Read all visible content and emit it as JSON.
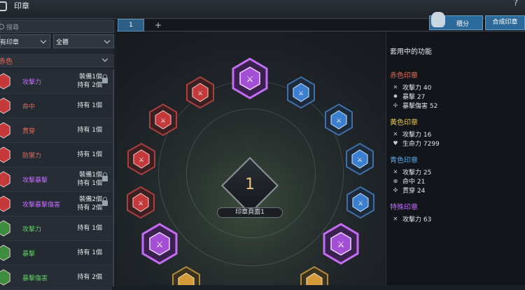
{
  "window": {
    "title": "印章",
    "help": "?"
  },
  "left": {
    "search_placeholder": "搜尋",
    "filter1": "有印章",
    "filter2": "全體",
    "category": "赤色",
    "items": [
      {
        "name": "攻擊力",
        "equipped": "裝備1個",
        "owned": "持有 2個",
        "locked": true,
        "color": "#c36bff"
      },
      {
        "name": "命中",
        "equipped": "",
        "owned": "持有 1個",
        "locked": false,
        "color": "#e86b5a"
      },
      {
        "name": "貫穿",
        "equipped": "",
        "owned": "持有 1個",
        "locked": false,
        "color": "#e86b5a"
      },
      {
        "name": "防禦力",
        "equipped": "",
        "owned": "持有 1個",
        "locked": false,
        "color": "#e86b5a"
      },
      {
        "name": "攻擊暴擊",
        "equipped": "裝備1個",
        "owned": "持有 1個",
        "locked": true,
        "color": "#c36bff"
      },
      {
        "name": "攻擊暴擊傷害",
        "equipped": "裝備2個",
        "owned": "持有 2個",
        "locked": true,
        "color": "#c36bff"
      },
      {
        "name": "攻擊力",
        "equipped": "",
        "owned": "持有 1個",
        "locked": false,
        "color": "#5fd05f"
      },
      {
        "name": "暴擊",
        "equipped": "",
        "owned": "持有 1個",
        "locked": false,
        "color": "#5fd05f"
      },
      {
        "name": "暴擊傷害",
        "equipped": "",
        "owned": "持有 2個",
        "locked": false,
        "color": "#5fd05f"
      }
    ]
  },
  "tabs": {
    "active": "1",
    "add": "+"
  },
  "core": {
    "number": "1",
    "label": "印章頁面1"
  },
  "top_buttons": {
    "score": "積分",
    "merge": "合成印章"
  },
  "panel": {
    "title": "套用中的功能",
    "groups": [
      {
        "name": "赤色印章",
        "color": "#e86b5a",
        "stats": [
          {
            "icon": "swords-icon",
            "glyph": "✕",
            "text": "攻擊力 40"
          },
          {
            "icon": "burst-icon",
            "glyph": "✸",
            "text": "暴擊 27"
          },
          {
            "icon": "burst-damage-icon",
            "glyph": "✢",
            "text": "暴擊傷害 52"
          }
        ]
      },
      {
        "name": "黃色印章",
        "color": "#e6c44f",
        "stats": [
          {
            "icon": "swords-icon",
            "glyph": "✕",
            "text": "攻擊力 16"
          },
          {
            "icon": "heart-icon",
            "glyph": "♥",
            "text": "生命力 7299"
          }
        ]
      },
      {
        "name": "青色印章",
        "color": "#5aa8e8",
        "stats": [
          {
            "icon": "swords-icon",
            "glyph": "✕",
            "text": "攻擊力 25"
          },
          {
            "icon": "target-icon",
            "glyph": "⊕",
            "text": "命中 21"
          },
          {
            "icon": "pierce-icon",
            "glyph": "✣",
            "text": "貫穿 24"
          }
        ]
      },
      {
        "name": "特殊印章",
        "color": "#c36bff",
        "stats": [
          {
            "icon": "swords-icon",
            "glyph": "✕",
            "text": "攻擊力 63"
          }
        ]
      }
    ]
  }
}
